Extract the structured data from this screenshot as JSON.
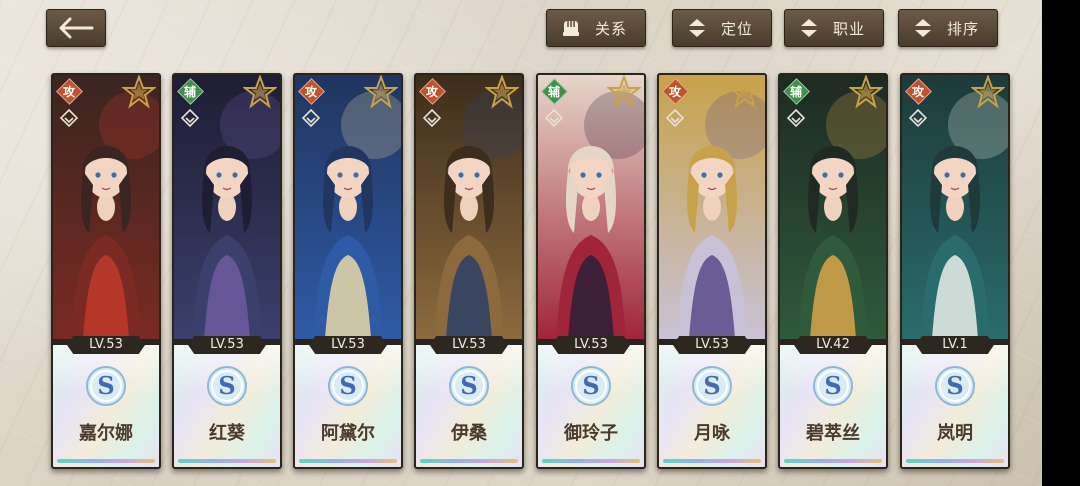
{
  "header": {
    "back_icon": "back-arrow-icon",
    "buttons": [
      {
        "id": "relation",
        "label": "关系",
        "icon": "fist-icon"
      },
      {
        "id": "position",
        "label": "定位",
        "icon": "sort-arrows-icon"
      },
      {
        "id": "class",
        "label": "职业",
        "icon": "sort-arrows-icon"
      },
      {
        "id": "sort",
        "label": "排序",
        "icon": "sort-arrows-icon"
      }
    ]
  },
  "colors": {
    "attack_badge": "#c2522a",
    "support_badge": "#3f8f4a",
    "star_gold": "#c8a24a",
    "button_bg": "#5a4a38"
  },
  "characters": [
    {
      "name": "嘉尔娜",
      "level": "LV.53",
      "role": "攻",
      "rank": "S",
      "palette": [
        "#7a2a22",
        "#c0392b",
        "#3a2520"
      ]
    },
    {
      "name": "红葵",
      "level": "LV.53",
      "role": "辅",
      "rank": "S",
      "palette": [
        "#3b3f6b",
        "#6f5aa0",
        "#1e1d33"
      ]
    },
    {
      "name": "阿黛尔",
      "level": "LV.53",
      "role": "攻",
      "rank": "S",
      "palette": [
        "#2f5aa5",
        "#e9d9a6",
        "#20355f"
      ]
    },
    {
      "name": "伊桑",
      "level": "LV.53",
      "role": "攻",
      "rank": "S",
      "palette": [
        "#8c6a3e",
        "#2c3f66",
        "#3d2d1c"
      ]
    },
    {
      "name": "御玲子",
      "level": "LV.53",
      "role": "辅",
      "rank": "S",
      "palette": [
        "#a0253a",
        "#2b2037",
        "#e6d6c9"
      ]
    },
    {
      "name": "月咏",
      "level": "LV.53",
      "role": "攻",
      "rank": "S",
      "palette": [
        "#c9c2d6",
        "#5a4a8a",
        "#c8a24a"
      ]
    },
    {
      "name": "碧萃丝",
      "level": "LV.42",
      "role": "辅",
      "rank": "S",
      "palette": [
        "#2f5a3b",
        "#d9a54a",
        "#1e2a22"
      ]
    },
    {
      "name": "岚明",
      "level": "LV.1",
      "role": "攻",
      "rank": "S",
      "palette": [
        "#2a6b6b",
        "#e9eee8",
        "#1e3a3a"
      ]
    }
  ]
}
